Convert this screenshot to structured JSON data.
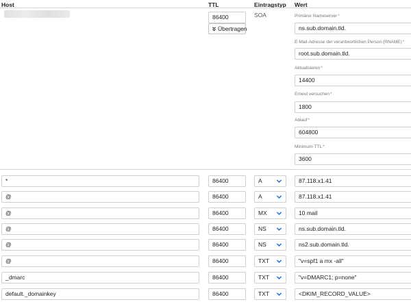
{
  "header": {
    "host": "Host",
    "ttl": "TTL",
    "type": "Eintragstyp",
    "value": "Wert"
  },
  "soa": {
    "ttl": "86400",
    "transfer_button": "Übertragen",
    "transfer_icon": "double-chevron-down-icon",
    "type": "SOA",
    "fields": [
      {
        "label": "Primärer Nameserver",
        "value": "ns.sub.domain.tld."
      },
      {
        "label": "E-Mail-Adresse der verantwortlichen Person (RNAME)",
        "value": "root.sub.domain.tld."
      },
      {
        "label": "Aktualisieren",
        "value": "14400"
      },
      {
        "label": "Erneut versuchen",
        "value": "1800"
      },
      {
        "label": "Ablauf",
        "value": "604800"
      },
      {
        "label": "Minimum-TTL",
        "value": "3600"
      }
    ],
    "required_marker": "*"
  },
  "records": [
    {
      "host": "*",
      "ttl": "86400",
      "type": "A",
      "value": "87.118.x1.41"
    },
    {
      "host": "@",
      "ttl": "86400",
      "type": "A",
      "value": "87.118.x1.41"
    },
    {
      "host": "@",
      "ttl": "86400",
      "type": "MX",
      "value": "10 mail"
    },
    {
      "host": "@",
      "ttl": "86400",
      "type": "NS",
      "value": "ns.sub.domain.tld."
    },
    {
      "host": "@",
      "ttl": "86400",
      "type": "NS",
      "value": "ns2.sub.domain.tld."
    },
    {
      "host": "@",
      "ttl": "86400",
      "type": "TXT",
      "value": "\"v=spf1 a mx -all\""
    },
    {
      "host": "_dmarc",
      "ttl": "86400",
      "type": "TXT",
      "value": "\"v=DMARC1; p=none\""
    },
    {
      "host": "default._domainkey",
      "ttl": "86400",
      "type": "TXT",
      "value": "<DKIM_RECORD_VALUE>"
    }
  ],
  "colors": {
    "chevron": "#1f6fd1",
    "required": "#e06a6a",
    "border": "#cfcfcf"
  }
}
